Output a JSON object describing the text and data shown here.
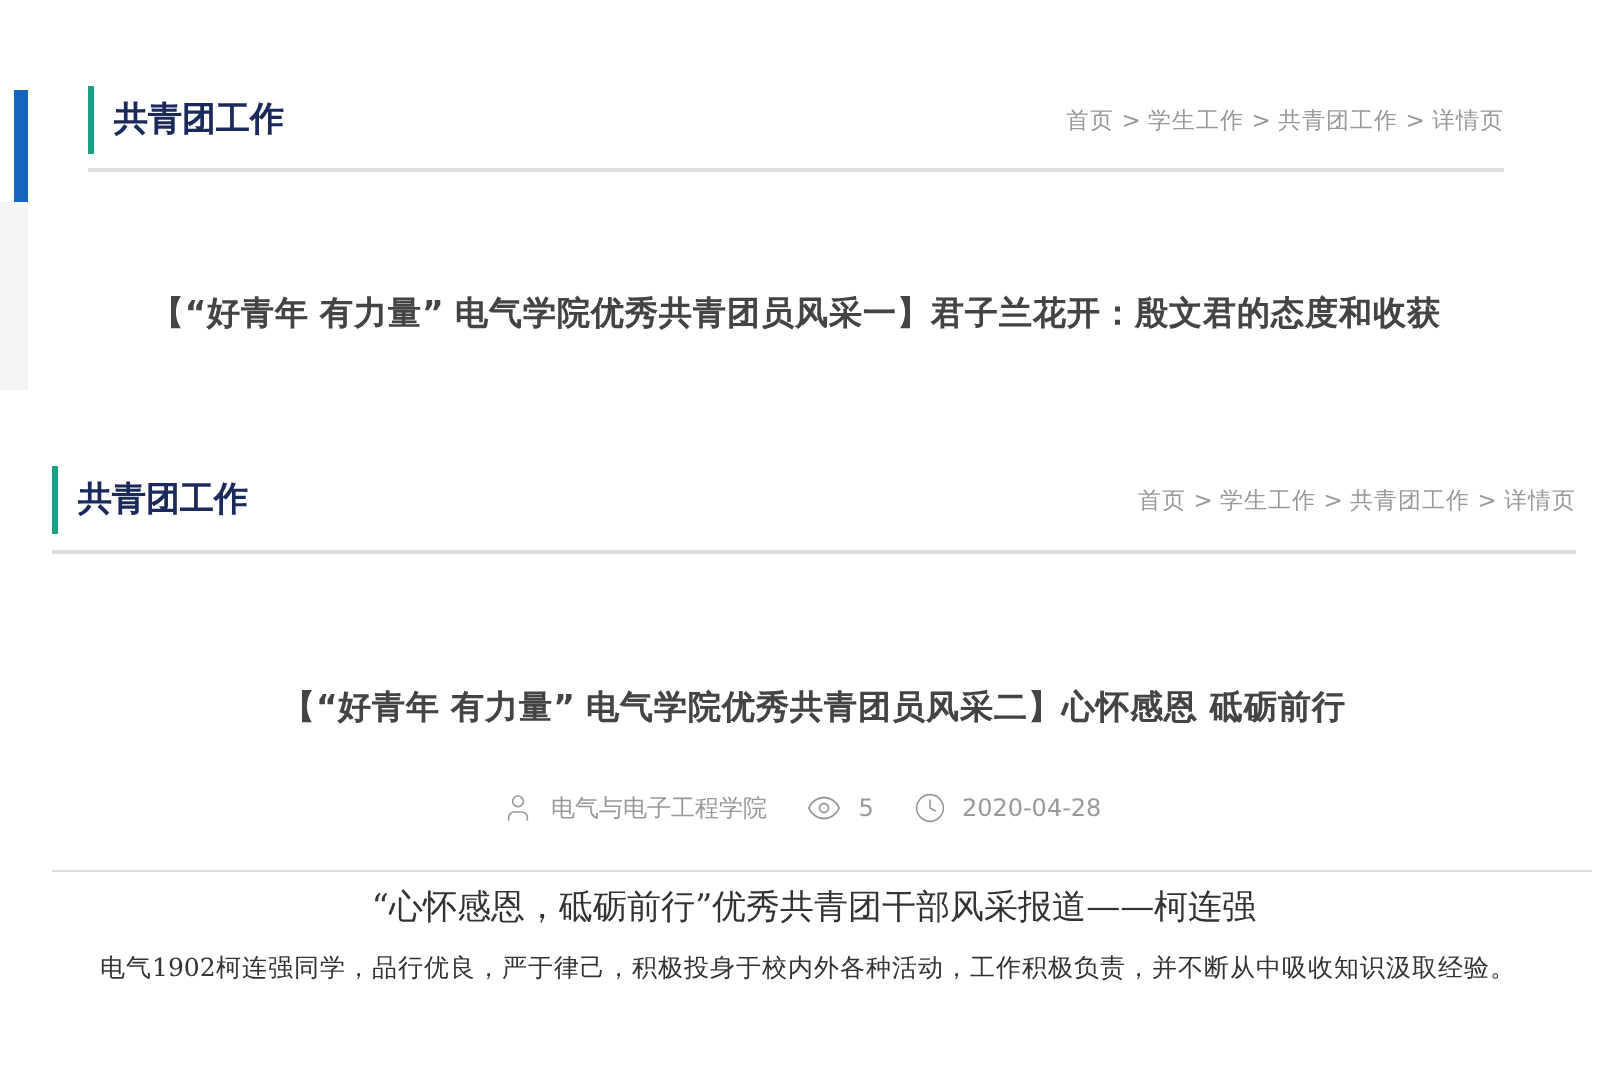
{
  "pages": [
    {
      "header": {
        "title": "共青团工作",
        "breadcrumb": "首页 > 学生工作 > 共青团工作 > 详情页"
      },
      "article": {
        "title": "【“好青年 有力量” 电气学院优秀共青团员风采一】君子兰花开：殷文君的态度和收获"
      }
    },
    {
      "header": {
        "title": "共青团工作",
        "breadcrumb": "首页 > 学生工作 > 共青团工作 > 详情页"
      },
      "article": {
        "title": "【“好青年 有力量” 电气学院优秀共青团员风采二】心怀感恩 砥砺前行",
        "meta": {
          "author": "电气与电子工程学院",
          "views": "5",
          "date": "2020-04-28"
        },
        "subtitle": "“心怀感恩，砥砺前行”优秀共青团干部风采报道——柯连强",
        "body": "电气1902柯连强同学，品行优良，严于律己，积极投身于校内外各种活动，工作积极负责，并不断从中吸收知识汲取经验。"
      }
    }
  ]
}
